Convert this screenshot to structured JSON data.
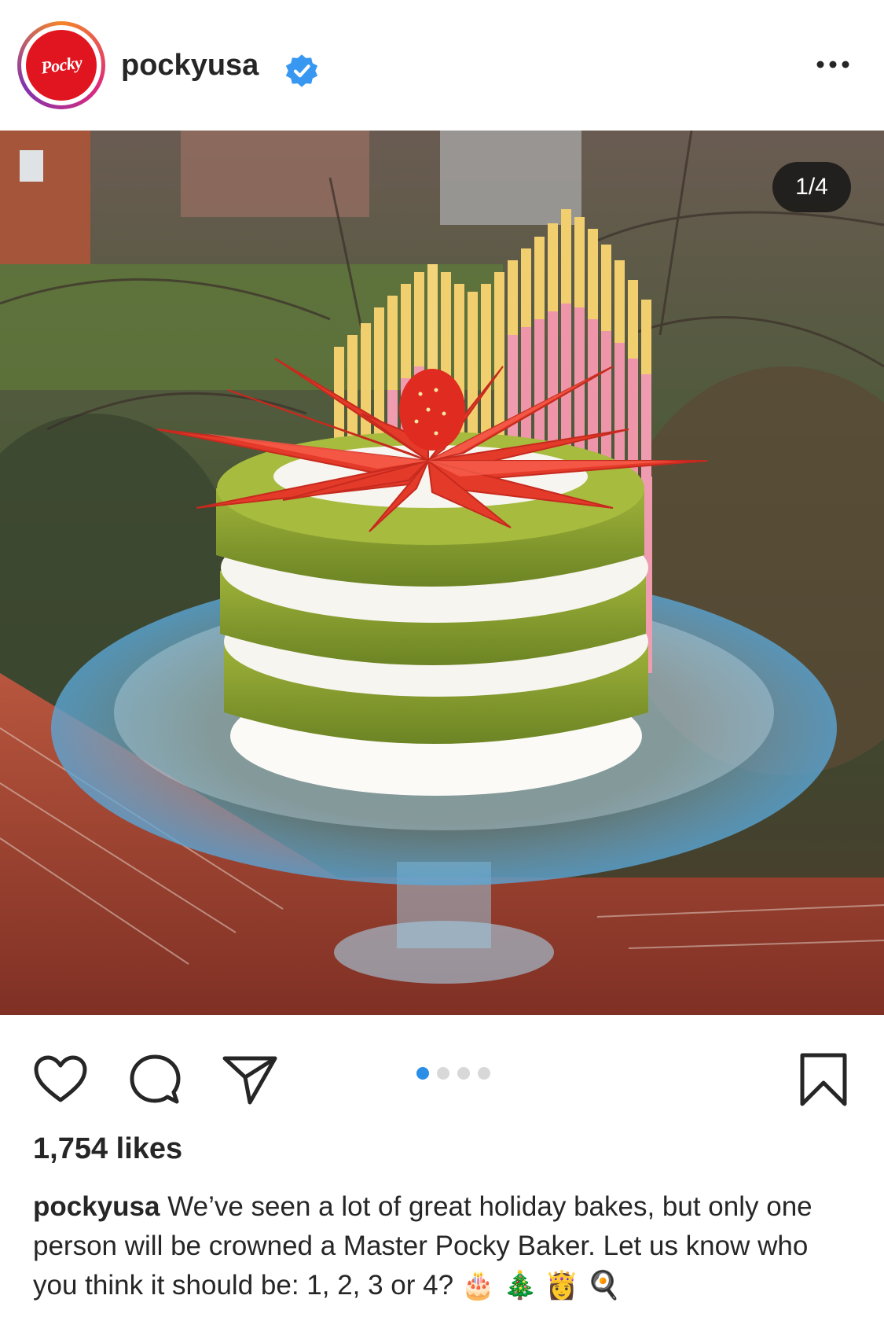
{
  "header": {
    "avatar_text": "Pocky",
    "username": "pockyusa",
    "verified_icon": "verified-badge-icon",
    "more_icon": "more-options-icon"
  },
  "photo": {
    "counter": "1/4"
  },
  "carousel": {
    "total": 4,
    "active_index": 0
  },
  "actions": {
    "like_icon": "heart-icon",
    "comment_icon": "comment-icon",
    "share_icon": "share-icon",
    "save_icon": "bookmark-icon"
  },
  "post": {
    "likes": "1,754 likes",
    "caption_user": "pockyusa",
    "caption_text": "We’ve seen a lot of great holiday bakes, but only one person will be crowned a Master Pocky Baker. Let us know who you think it should be: 1, 2, 3 or 4? 🎂 🎄 👸 🍳"
  },
  "colors": {
    "accent_blue": "#2b8ee6",
    "pocky_red": "#e1151f",
    "text": "#262626"
  }
}
